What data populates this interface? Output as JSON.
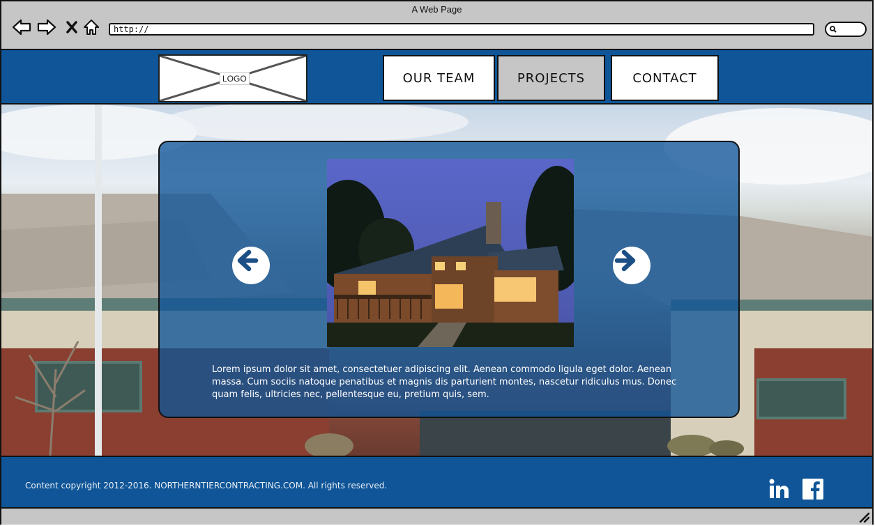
{
  "window": {
    "title": "A Web Page",
    "address": "http://"
  },
  "icons": {
    "back": "back-arrow-icon",
    "forward": "forward-arrow-icon",
    "stop": "stop-x-icon",
    "home": "home-icon",
    "search": "search-icon",
    "logo_placeholder": "image-placeholder-icon",
    "prev": "arrow-left-circle-icon",
    "next": "arrow-right-circle-icon",
    "linkedin": "linkedin-icon",
    "facebook": "facebook-icon",
    "resize": "resize-grip-icon"
  },
  "header": {
    "logo_text": "LOGO",
    "nav": [
      {
        "label": "OUR TEAM",
        "active": false
      },
      {
        "label": "PROJECTS",
        "active": true
      },
      {
        "label": "CONTACT",
        "active": false
      }
    ]
  },
  "carousel": {
    "caption": "Lorem ipsum dolor sit amet, consectetuer adipiscing elit. Aenean commodo ligula eget dolor. Aenean massa. Cum sociis natoque penatibus et magnis dis parturient montes, nascetur ridiculus mus. Donec quam felis, ultricies nec, pellentesque eu, pretium quis, sem."
  },
  "footer": {
    "copyright": "Content copyright 2012-2016. NORTHERNTIERCONTRACTING.COM. All rights reserved."
  },
  "colors": {
    "brand_blue": "#0f5597",
    "chrome_gray": "#c6c6c6",
    "active_nav": "#c6c6c6"
  }
}
